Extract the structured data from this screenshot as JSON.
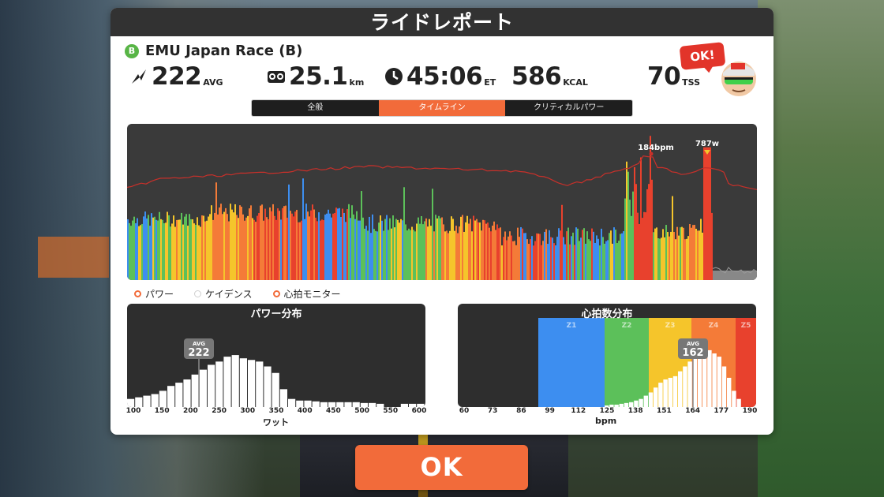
{
  "title": "ライドレポート",
  "ride": {
    "category_badge": "B",
    "name": "EMU Japan Race (B)"
  },
  "stats": {
    "power": {
      "value": "222",
      "unit": "AVG",
      "icon": "lightning-icon"
    },
    "distance": {
      "value": "25.1",
      "unit": "km",
      "icon": "bike-odometer-icon"
    },
    "time": {
      "value": "45:06",
      "unit": "ET",
      "icon": "clock-icon"
    },
    "energy": {
      "value": "586",
      "unit": "KCAL"
    },
    "tss": {
      "value": "70",
      "unit": "TSS"
    }
  },
  "ok_bubble": "OK!",
  "tabs": [
    "全般",
    "タイムライン",
    "クリティカルパワー"
  ],
  "active_tab": 1,
  "timeline": {
    "hr_peak_label": "184bpm",
    "power_peak_label": "787w"
  },
  "legend": [
    {
      "label": "パワー",
      "color": "#f26b3a",
      "selected": true
    },
    {
      "label": "ケイデンス",
      "color": "#cccccc",
      "selected": false
    },
    {
      "label": "心拍モニター",
      "color": "#f26b3a",
      "selected": true
    }
  ],
  "power_dist": {
    "title": "パワー分布",
    "avg_label": "AVG",
    "avg_value": "222",
    "x_ticks": [
      "100",
      "150",
      "200",
      "250",
      "300",
      "350",
      "400",
      "450",
      "500",
      "550",
      "600"
    ],
    "xlabel": "ワット"
  },
  "hr_dist": {
    "title": "心拍数分布",
    "avg_label": "AVG",
    "avg_value": "162",
    "zones": [
      "Z1",
      "Z2",
      "Z3",
      "Z4",
      "Z5"
    ],
    "x_ticks": [
      "60",
      "73",
      "86",
      "99",
      "112",
      "125",
      "138",
      "151",
      "164",
      "177",
      "190"
    ],
    "xlabel": "bpm"
  },
  "ok_button": "OK",
  "colors": {
    "accent": "#f26b3a",
    "zone_blue": "#3d8ef0",
    "zone_green": "#5cc05a",
    "zone_yellow": "#f5c52b",
    "zone_orange": "#f47b38",
    "zone_red": "#e8412d"
  }
}
